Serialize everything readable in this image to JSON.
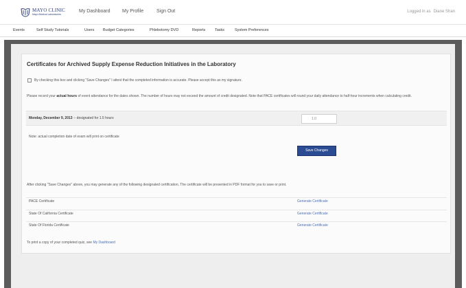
{
  "header": {
    "logo_name": "MAYO CLINIC",
    "logo_sub": "Mayo Medical Laboratories",
    "nav": [
      "My Dashboard",
      "My Profile",
      "Sign Out"
    ],
    "login_label": "Logged in as",
    "login_user": "Diane Shan"
  },
  "subnav": [
    "Events",
    "Self Study Tutorials",
    "Users",
    "Budget Categories",
    "Phlebotomy DVD",
    "Reports",
    "Tasks",
    "System Preferences"
  ],
  "page": {
    "title": "Certificates for Archived Supply Expense Reduction Initiatives in the Laboratory",
    "checkbox_label": "By checking this box and clicking \"Save Changes\" I attest that the completed information is accurate. Please accept this as my signature.",
    "instr_pre": "Please record your ",
    "instr_bold": "actual hours",
    "instr_post": " of event attendance for the dates shown. The number of hours may not exceed the amount of credit designated. Note that PACE certificates will round your daily attendance to half-hour increments when calculating credit.",
    "session_date": "Monday, December 9, 2013",
    "session_note": " -- designated for 1.5 hours",
    "hours_value": "1.0",
    "completion_note": "Note: actual completion date of exam will print on certificate",
    "save_label": "Save Changes",
    "after_text": "After clicking \"Save Changes\" above, you may generate any of the following designated certification. The certificate will be presented in PDF format for you to save or print.",
    "certificates": [
      {
        "name": "PACE Certificate",
        "link": "Generate Certificate"
      },
      {
        "name": "State Of California Certificate",
        "link": "Generate Certificate"
      },
      {
        "name": "State Of Florida Certificate",
        "link": "Generate Certificate"
      }
    ],
    "footer_pre": "To print a copy of your completed quiz, see ",
    "footer_link": "My Dashboard"
  },
  "colors": {
    "accent": "#2b4c93",
    "link": "#4a6fb5",
    "page_bg": "#5c5c5c"
  }
}
